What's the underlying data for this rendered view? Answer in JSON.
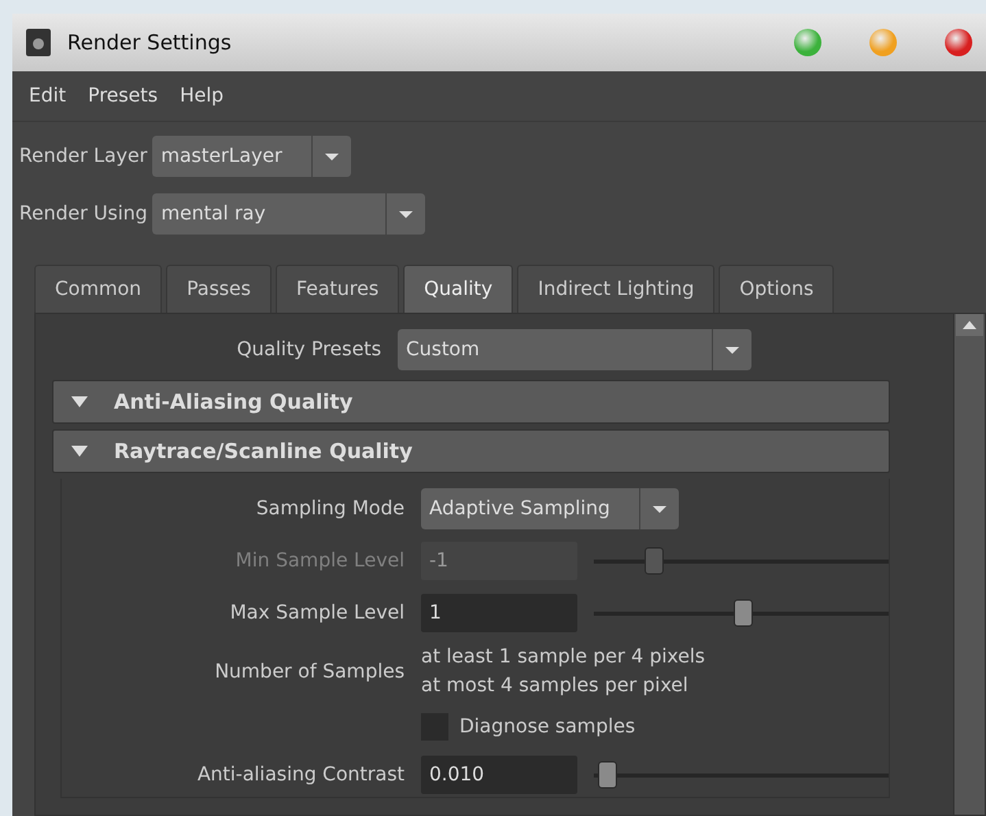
{
  "window": {
    "title": "Render Settings"
  },
  "menu": [
    "Edit",
    "Presets",
    "Help"
  ],
  "selectors": [
    {
      "label": "Render Layer",
      "value": "masterLayer"
    },
    {
      "label": "Render Using",
      "value": "mental ray"
    }
  ],
  "tabs": [
    {
      "label": "Common",
      "selected": false
    },
    {
      "label": "Passes",
      "selected": false
    },
    {
      "label": "Features",
      "selected": false
    },
    {
      "label": "Quality",
      "selected": true
    },
    {
      "label": "Indirect Lighting",
      "selected": false
    },
    {
      "label": "Options",
      "selected": false
    }
  ],
  "quality_presets": {
    "label": "Quality Presets",
    "value": "Custom"
  },
  "sections": [
    {
      "title": "Anti-Aliasing Quality",
      "expanded": true
    },
    {
      "title": "Raytrace/Scanline Quality",
      "expanded": true,
      "rows": [
        {
          "kind": "dropdown",
          "label": "Sampling Mode",
          "value": "Adaptive Sampling"
        },
        {
          "kind": "slider",
          "label": "Min Sample Level",
          "value": "-1",
          "level": 0.2,
          "disabled": true
        },
        {
          "kind": "slider",
          "label": "Max Sample Level",
          "value": "1",
          "level": 0.5,
          "disabled": false
        },
        {
          "kind": "info",
          "label": "Number of Samples",
          "lines": [
            "at least 1 sample per 4 pixels",
            "at most 4 samples per pixel"
          ]
        },
        {
          "kind": "checkbox",
          "label": "Diagnose samples",
          "checked": false
        },
        {
          "kind": "slider",
          "label": "Anti-aliasing Contrast",
          "value": "0.010",
          "level": 0.04,
          "disabled": false
        }
      ]
    }
  ]
}
